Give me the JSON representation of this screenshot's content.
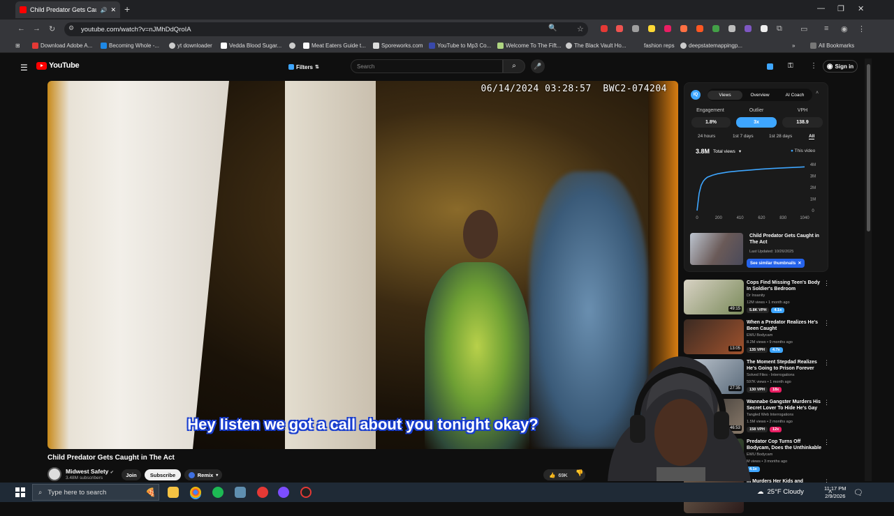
{
  "browser": {
    "tab_title": "Child Predator Gets Caught",
    "url": "youtube.com/watch?v=nJMhDdQroIA",
    "bookmarks": [
      "Download Adobe A...",
      "Becoming Whole -...",
      "yt downloader",
      "Vedda Blood Sugar...",
      "Meat Eaters Guide t...",
      "Sporeworks.com",
      "YouTube to Mp3 Co...",
      "Welcome To The Fift...",
      "The Black Vault Ho...",
      "fashion reps",
      "deepstatemappingp..."
    ],
    "all_bookmarks_label": "All Bookmarks"
  },
  "youtube": {
    "logo_text": "YouTube",
    "filters_label": "Filters",
    "search_placeholder": "Search",
    "signin_label": "Sign in"
  },
  "video": {
    "timestamp_overlay": "06/14/2024 03:28:57",
    "camera_id": "BWC2-074204",
    "caption": "Hey listen we got a call about you tonight okay?",
    "title": "Child Predator Gets Caught in The Act",
    "channel_name": "Midwest Safety",
    "channel_subs": "3.48M subscribers",
    "join_label": "Join",
    "subscribe_label": "Subscribe",
    "remix_label": "Remix",
    "like_count": "69K"
  },
  "iq_panel": {
    "badge": "IQ",
    "tabs": [
      "Views",
      "Overview",
      "AI Coach"
    ],
    "active_tab": "Views",
    "metrics": [
      {
        "label": "Engagement",
        "value": "1.8%"
      },
      {
        "label": "Outlier",
        "value": "3x"
      },
      {
        "label": "VPH",
        "value": "138.9"
      }
    ],
    "periods": [
      "24 hours",
      "1st 7 days",
      "1st 28 days",
      "All"
    ],
    "active_period": "All",
    "total_views": "3.8M",
    "total_views_label": "Total views",
    "legend": "This video",
    "rec_title": "Child Predator Gets Caught in The Act",
    "rec_updated": "Last Updated: 10/26/2025",
    "similar_btn": "See similar thumbnails",
    "accent": "#3ea6ff"
  },
  "chart_data": {
    "type": "line",
    "x": [
      0,
      20,
      40,
      60,
      80,
      100,
      150,
      200,
      300,
      410,
      520,
      620,
      730,
      830,
      940,
      1040
    ],
    "x_ticks": [
      "0",
      "200",
      "410",
      "620",
      "830",
      "1040"
    ],
    "y_ticks": [
      "0",
      "1M",
      "2M",
      "3M",
      "4M"
    ],
    "ylim": [
      0,
      4000000
    ],
    "series": [
      {
        "values": [
          0,
          1500000,
          2200000,
          2550000,
          2750000,
          2900000,
          3080000,
          3200000,
          3350000,
          3450000,
          3530000,
          3600000,
          3660000,
          3710000,
          3750000,
          3800000
        ]
      }
    ]
  },
  "recommendations": [
    {
      "title": "Cops Find Missing Teen's Body In Soldier's Bedroom",
      "channel": "Dr Insanity",
      "meta": "12M views • 1 month ago",
      "vph": "5.8K VPH",
      "outlier": "4.1x",
      "outlier_color": "#3ea6ff",
      "duration": "49:15"
    },
    {
      "title": "When a Predator Realizes He's Been Caught",
      "channel": "EWU Bodycam",
      "meta": "8.2M views • 9 months ago",
      "vph": "135 VPH",
      "outlier": "4.7x",
      "outlier_color": "#3ea6ff",
      "duration": "13:05"
    },
    {
      "title": "The Moment Stepdad Realizes He's Going to Prison Forever",
      "channel": "Solved Files - Interrogations",
      "meta": "597K views • 1 month ago",
      "vph": "130 VPH",
      "outlier": "18x",
      "outlier_color": "#e91e63",
      "duration": "27:35"
    },
    {
      "title": "Wannabe Gangster Murders His Secret Lover To Hide He's Gay",
      "channel": "Tangled Web Interrogations",
      "meta": "1.5M views • 2 months ago",
      "vph": "158 VPH",
      "outlier": "12x",
      "outlier_color": "#e91e63",
      "duration": "46:53"
    },
    {
      "title": "Predator Cop Turns Off Bodycam, Does the Unthinkable",
      "channel": "EWU Bodycam",
      "meta": "M views • 3 months ago",
      "vph": "",
      "outlier": "4.1x",
      "outlier_color": "#3ea6ff",
      "duration": ""
    },
    {
      "title": "m Murders Her Kids and",
      "channel": "",
      "meta": "",
      "vph": "",
      "outlier": "",
      "outlier_color": "#3ea6ff",
      "duration": ""
    }
  ],
  "taskbar": {
    "search_placeholder": "Type here to search",
    "weather": "25°F  Cloudy",
    "time": "11:17 PM",
    "date": "2/9/2026"
  }
}
